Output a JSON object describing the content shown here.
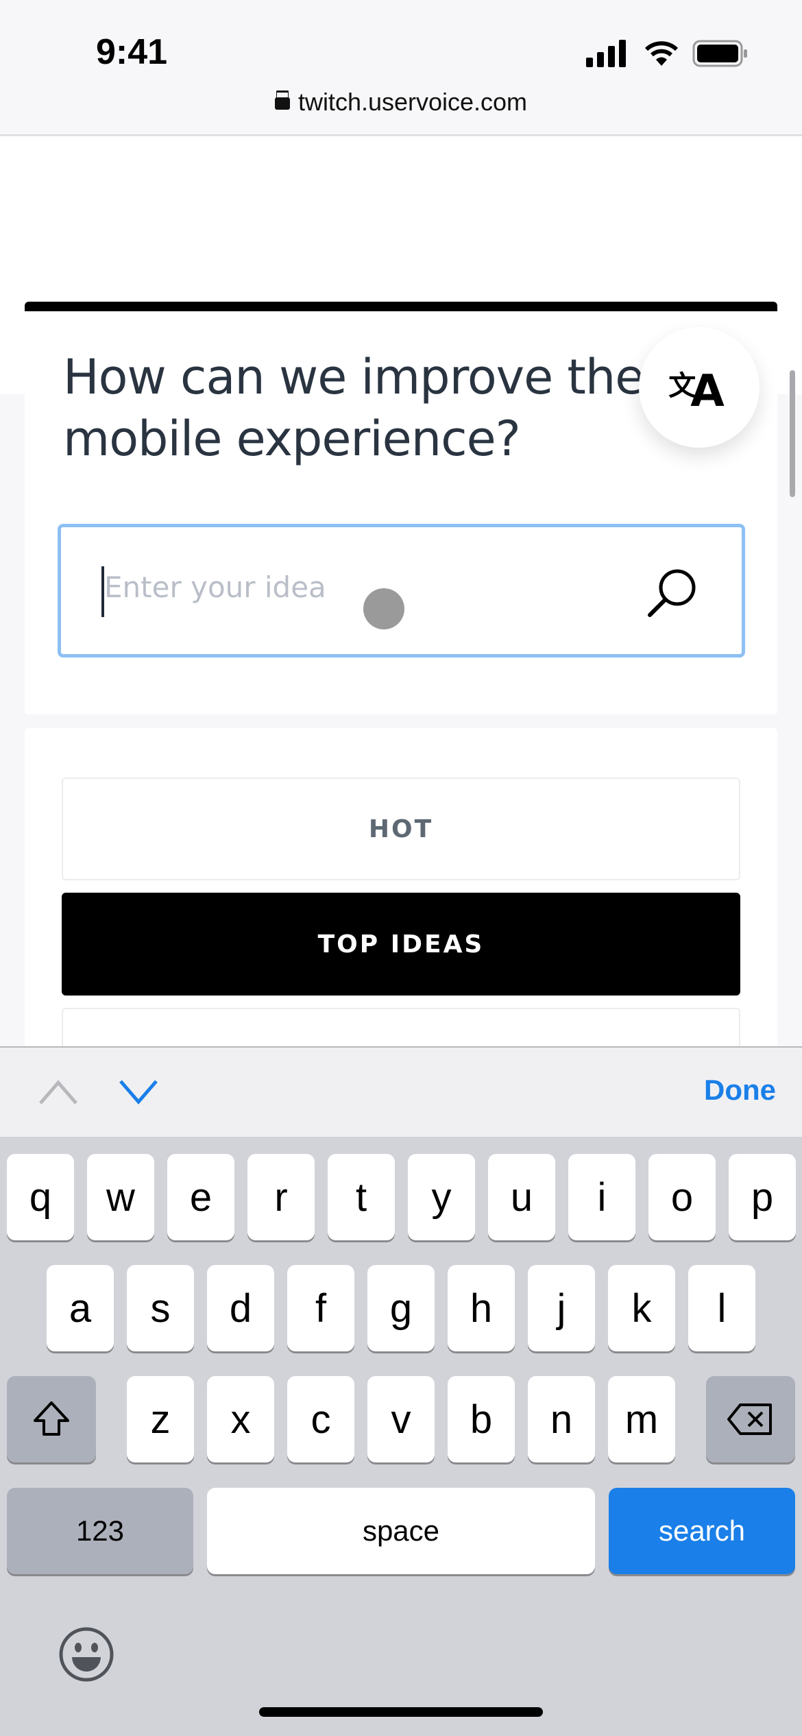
{
  "status_bar": {
    "time": "9:41",
    "url": "twitch.uservoice.com"
  },
  "page": {
    "title": "How can we improve the mobile experience?",
    "search_placeholder": "Enter your idea",
    "translate_icon": "translate-icon"
  },
  "filters": {
    "tabs": [
      {
        "label": "HOT",
        "selected": false
      },
      {
        "label": "TOP IDEAS",
        "selected": true
      },
      {
        "label": "",
        "selected": false
      }
    ]
  },
  "accessory": {
    "done_label": "Done"
  },
  "keyboard": {
    "row1": [
      "q",
      "w",
      "e",
      "r",
      "t",
      "y",
      "u",
      "i",
      "o",
      "p"
    ],
    "row2": [
      "a",
      "s",
      "d",
      "f",
      "g",
      "h",
      "j",
      "k",
      "l"
    ],
    "row3": [
      "z",
      "x",
      "c",
      "v",
      "b",
      "n",
      "m"
    ],
    "numbers_label": "123",
    "space_label": "space",
    "search_label": "search"
  },
  "colors": {
    "accent": "#1a7fe8",
    "input_focus": "#8dc0f3",
    "selected_tab": "#000000"
  }
}
